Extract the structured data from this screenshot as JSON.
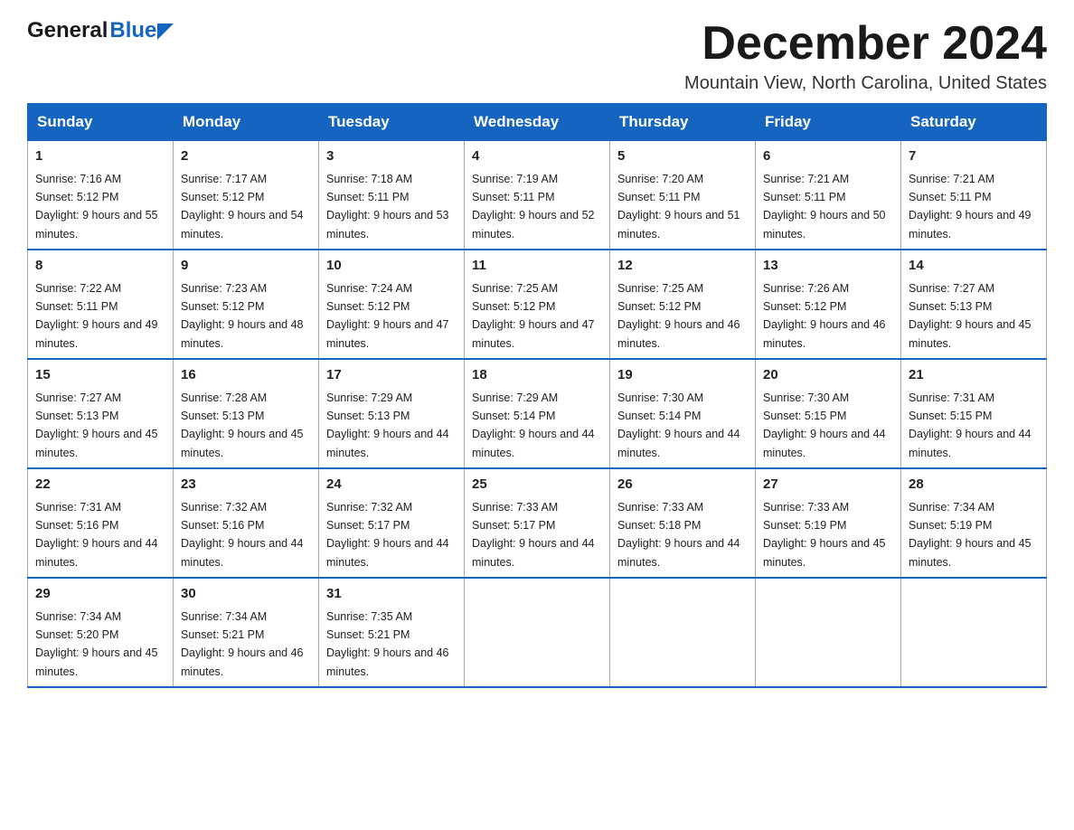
{
  "header": {
    "logo_general": "General",
    "logo_blue": "Blue",
    "month_title": "December 2024",
    "location": "Mountain View, North Carolina, United States"
  },
  "calendar": {
    "days_of_week": [
      "Sunday",
      "Monday",
      "Tuesday",
      "Wednesday",
      "Thursday",
      "Friday",
      "Saturday"
    ],
    "weeks": [
      [
        {
          "day": "1",
          "sunrise": "7:16 AM",
          "sunset": "5:12 PM",
          "daylight": "9 hours and 55 minutes."
        },
        {
          "day": "2",
          "sunrise": "7:17 AM",
          "sunset": "5:12 PM",
          "daylight": "9 hours and 54 minutes."
        },
        {
          "day": "3",
          "sunrise": "7:18 AM",
          "sunset": "5:11 PM",
          "daylight": "9 hours and 53 minutes."
        },
        {
          "day": "4",
          "sunrise": "7:19 AM",
          "sunset": "5:11 PM",
          "daylight": "9 hours and 52 minutes."
        },
        {
          "day": "5",
          "sunrise": "7:20 AM",
          "sunset": "5:11 PM",
          "daylight": "9 hours and 51 minutes."
        },
        {
          "day": "6",
          "sunrise": "7:21 AM",
          "sunset": "5:11 PM",
          "daylight": "9 hours and 50 minutes."
        },
        {
          "day": "7",
          "sunrise": "7:21 AM",
          "sunset": "5:11 PM",
          "daylight": "9 hours and 49 minutes."
        }
      ],
      [
        {
          "day": "8",
          "sunrise": "7:22 AM",
          "sunset": "5:11 PM",
          "daylight": "9 hours and 49 minutes."
        },
        {
          "day": "9",
          "sunrise": "7:23 AM",
          "sunset": "5:12 PM",
          "daylight": "9 hours and 48 minutes."
        },
        {
          "day": "10",
          "sunrise": "7:24 AM",
          "sunset": "5:12 PM",
          "daylight": "9 hours and 47 minutes."
        },
        {
          "day": "11",
          "sunrise": "7:25 AM",
          "sunset": "5:12 PM",
          "daylight": "9 hours and 47 minutes."
        },
        {
          "day": "12",
          "sunrise": "7:25 AM",
          "sunset": "5:12 PM",
          "daylight": "9 hours and 46 minutes."
        },
        {
          "day": "13",
          "sunrise": "7:26 AM",
          "sunset": "5:12 PM",
          "daylight": "9 hours and 46 minutes."
        },
        {
          "day": "14",
          "sunrise": "7:27 AM",
          "sunset": "5:13 PM",
          "daylight": "9 hours and 45 minutes."
        }
      ],
      [
        {
          "day": "15",
          "sunrise": "7:27 AM",
          "sunset": "5:13 PM",
          "daylight": "9 hours and 45 minutes."
        },
        {
          "day": "16",
          "sunrise": "7:28 AM",
          "sunset": "5:13 PM",
          "daylight": "9 hours and 45 minutes."
        },
        {
          "day": "17",
          "sunrise": "7:29 AM",
          "sunset": "5:13 PM",
          "daylight": "9 hours and 44 minutes."
        },
        {
          "day": "18",
          "sunrise": "7:29 AM",
          "sunset": "5:14 PM",
          "daylight": "9 hours and 44 minutes."
        },
        {
          "day": "19",
          "sunrise": "7:30 AM",
          "sunset": "5:14 PM",
          "daylight": "9 hours and 44 minutes."
        },
        {
          "day": "20",
          "sunrise": "7:30 AM",
          "sunset": "5:15 PM",
          "daylight": "9 hours and 44 minutes."
        },
        {
          "day": "21",
          "sunrise": "7:31 AM",
          "sunset": "5:15 PM",
          "daylight": "9 hours and 44 minutes."
        }
      ],
      [
        {
          "day": "22",
          "sunrise": "7:31 AM",
          "sunset": "5:16 PM",
          "daylight": "9 hours and 44 minutes."
        },
        {
          "day": "23",
          "sunrise": "7:32 AM",
          "sunset": "5:16 PM",
          "daylight": "9 hours and 44 minutes."
        },
        {
          "day": "24",
          "sunrise": "7:32 AM",
          "sunset": "5:17 PM",
          "daylight": "9 hours and 44 minutes."
        },
        {
          "day": "25",
          "sunrise": "7:33 AM",
          "sunset": "5:17 PM",
          "daylight": "9 hours and 44 minutes."
        },
        {
          "day": "26",
          "sunrise": "7:33 AM",
          "sunset": "5:18 PM",
          "daylight": "9 hours and 44 minutes."
        },
        {
          "day": "27",
          "sunrise": "7:33 AM",
          "sunset": "5:19 PM",
          "daylight": "9 hours and 45 minutes."
        },
        {
          "day": "28",
          "sunrise": "7:34 AM",
          "sunset": "5:19 PM",
          "daylight": "9 hours and 45 minutes."
        }
      ],
      [
        {
          "day": "29",
          "sunrise": "7:34 AM",
          "sunset": "5:20 PM",
          "daylight": "9 hours and 45 minutes."
        },
        {
          "day": "30",
          "sunrise": "7:34 AM",
          "sunset": "5:21 PM",
          "daylight": "9 hours and 46 minutes."
        },
        {
          "day": "31",
          "sunrise": "7:35 AM",
          "sunset": "5:21 PM",
          "daylight": "9 hours and 46 minutes."
        },
        null,
        null,
        null,
        null
      ]
    ]
  }
}
